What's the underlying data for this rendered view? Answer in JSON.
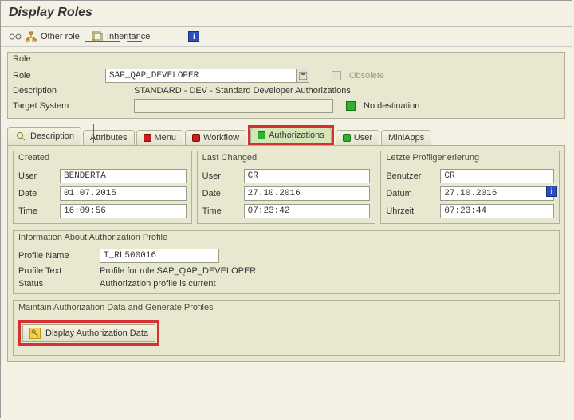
{
  "title": "Display Roles",
  "toolbar": {
    "other_role": "Other role",
    "inheritance": "Inheritance"
  },
  "role_group": {
    "title": "Role",
    "role_label": "Role",
    "role_value": "SAP_QAP_DEVELOPER",
    "obsolete_label": "Obsolete",
    "description_label": "Description",
    "description_value": "STANDARD - DEV - Standard Developer Authorizations",
    "target_system_label": "Target System",
    "target_system_value": "",
    "no_destination": "No destination"
  },
  "tabs": {
    "description": "Description",
    "attributes": "Attributes",
    "menu": "Menu",
    "workflow": "Workflow",
    "authorizations": "Authorizations",
    "user": "User",
    "miniapps": "MiniApps"
  },
  "created": {
    "title": "Created",
    "user_label": "User",
    "user_value": "BENDERTA",
    "date_label": "Date",
    "date_value": "01.07.2015",
    "time_label": "Time",
    "time_value": "16:09:56"
  },
  "lastchanged": {
    "title": "Last Changed",
    "user_label": "User",
    "user_value": "CR",
    "date_label": "Date",
    "date_value": "27.10.2016",
    "time_label": "Time",
    "time_value": "07:23:42"
  },
  "lastprofile": {
    "title": "Letzte Profilgenerierung",
    "user_label": "Benutzer",
    "user_value": "CR",
    "date_label": "Datum",
    "date_value": "27.10.2016",
    "time_label": "Uhrzeit",
    "time_value": "07:23:44"
  },
  "profile": {
    "title": "Information About Authorization Profile",
    "name_label": "Profile Name",
    "name_value": "T_RL500016",
    "text_label": "Profile Text",
    "text_value": "Profile for role SAP_QAP_DEVELOPER",
    "status_label": "Status",
    "status_text": "Authorization profile is current"
  },
  "maintain": {
    "title": "Maintain Authorization Data and Generate Profiles",
    "button": "Display Authorization Data"
  }
}
